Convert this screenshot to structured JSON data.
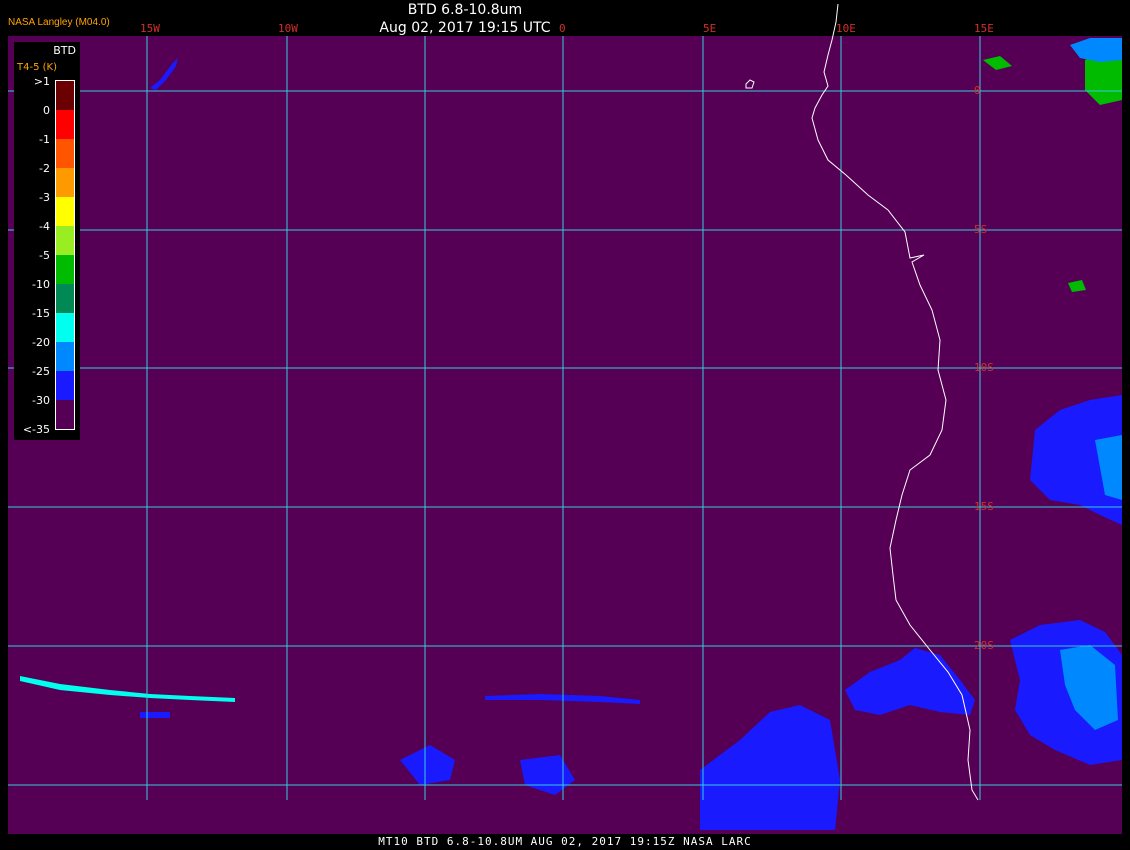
{
  "header": {
    "title": "BTD 6.8-10.8um",
    "timestamp": "Aug 02, 2017 19:15 UTC",
    "org": "NASA Langley (M04.0)"
  },
  "legend": {
    "title": "BTD",
    "unit": "T4-5 (K)",
    "entries": [
      {
        "label": ">1",
        "color": "#6b0000"
      },
      {
        "label": "0",
        "color": "#ff0000"
      },
      {
        "label": "-1",
        "color": "#ff5500"
      },
      {
        "label": "-2",
        "color": "#ff9900"
      },
      {
        "label": "-3",
        "color": "#ffff00"
      },
      {
        "label": "-4",
        "color": "#99ee22"
      },
      {
        "label": "-5",
        "color": "#00bb00"
      },
      {
        "label": "-10",
        "color": "#008855"
      },
      {
        "label": "-15",
        "color": "#00ffee"
      },
      {
        "label": "-20",
        "color": "#0088ff"
      },
      {
        "label": "-25",
        "color": "#1a1aff"
      },
      {
        "label": "-30",
        "color": "#550055"
      },
      {
        "label": "<-35",
        "color": ""
      }
    ]
  },
  "map": {
    "background": "#550055",
    "grid_color": "#33ccdd",
    "coast_color": "#ffffff",
    "lon_labels": [
      "15W",
      "10W",
      "0",
      "5E",
      "10E",
      "15E"
    ],
    "lat_labels": [
      "0",
      "5S",
      "10S",
      "15S",
      "20S"
    ]
  },
  "footer": "MT10  BTD 6.8-10.8UM   AUG 02, 2017 19:15Z   NASA LARC"
}
